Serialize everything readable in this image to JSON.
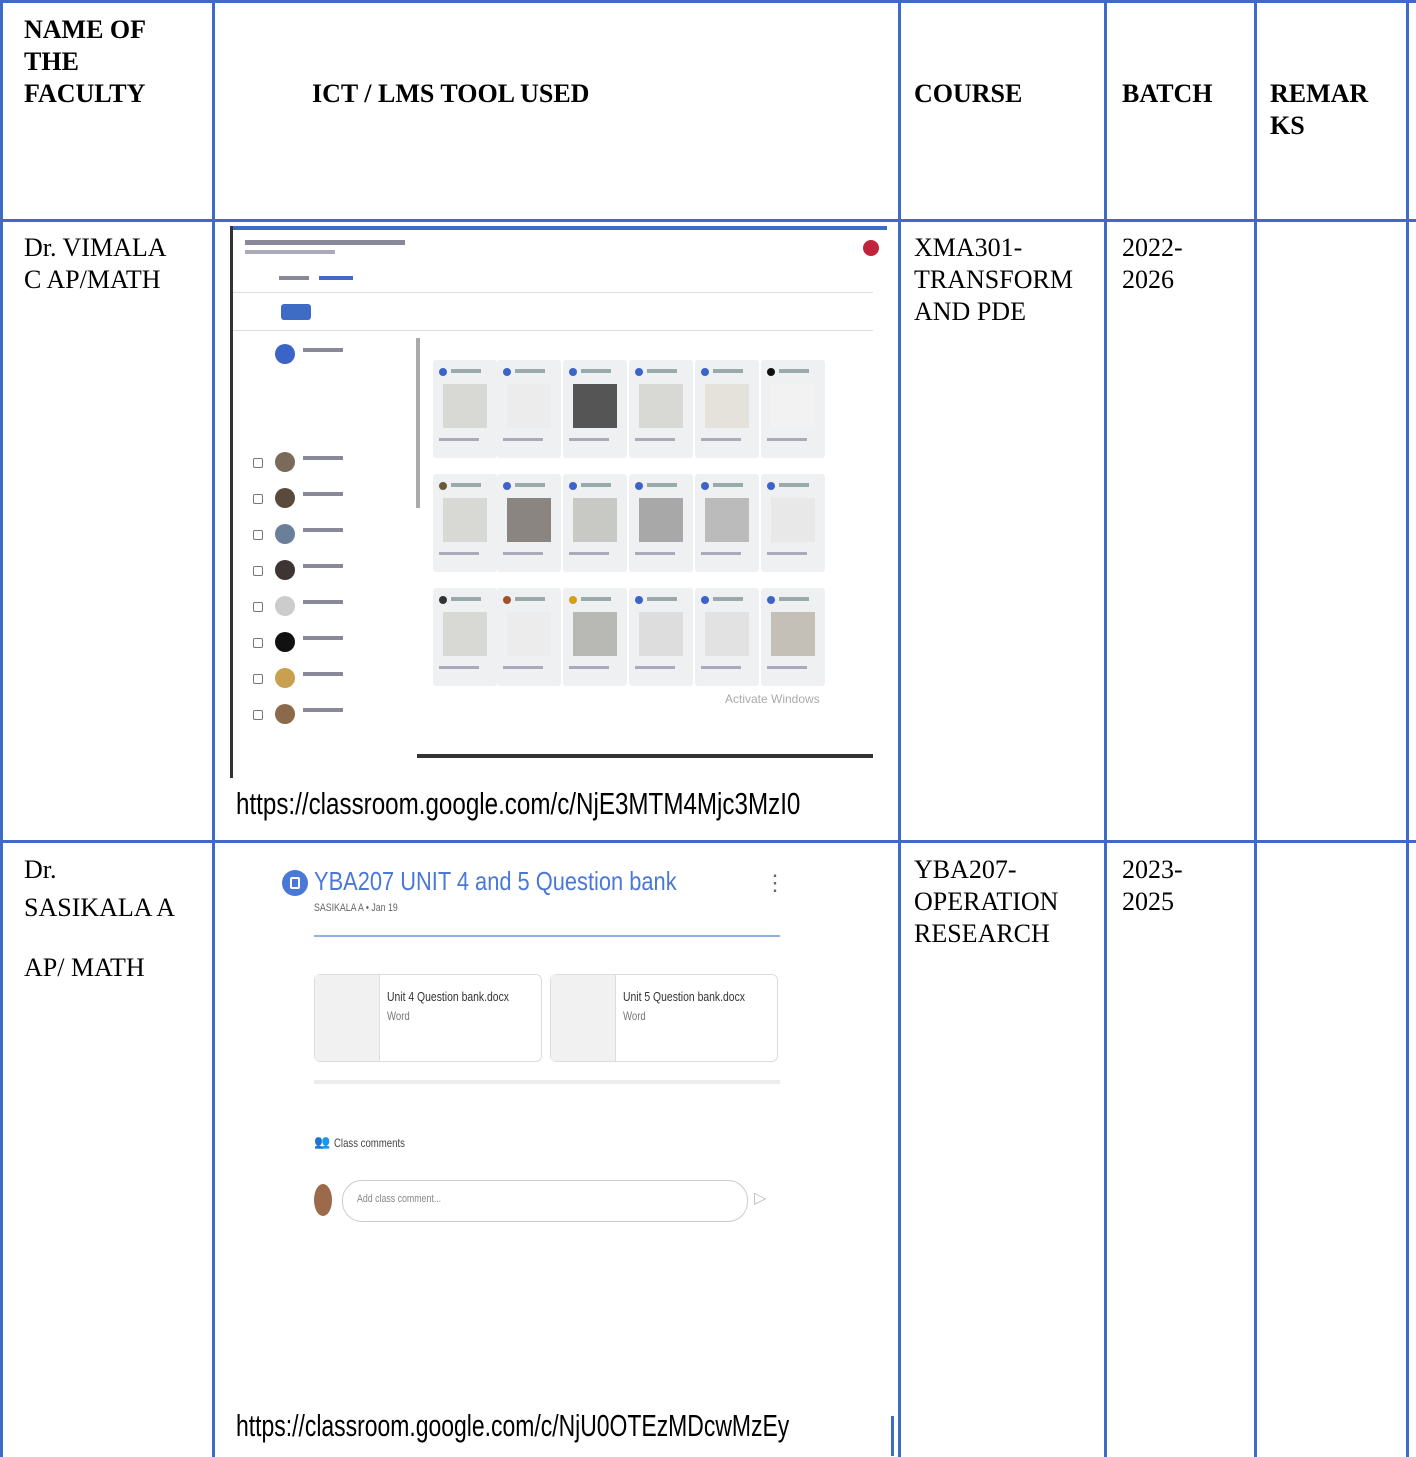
{
  "table": {
    "headers": {
      "faculty": [
        "NAME OF",
        "THE",
        "FACULTY"
      ],
      "tool": "ICT / LMS TOOL USED",
      "course": "COURSE",
      "batch": "BATCH",
      "remarks": [
        "REMAR",
        "KS"
      ]
    },
    "rows": [
      {
        "faculty": [
          "Dr. VIMALA",
          "C AP/MATH"
        ],
        "course": [
          "XMA301-",
          "TRANSFORM",
          "AND PDE"
        ],
        "batch": [
          "2022-",
          "2026"
        ],
        "remarks": "",
        "link": "https://classroom.google.com/c/NjE3MTM4Mjc3MzI0",
        "screenshot": {
          "watermark": "Activate Windows"
        }
      },
      {
        "faculty": [
          "Dr.",
          "SASIKALA A",
          "AP/ MATH"
        ],
        "course": [
          "YBA207-",
          "OPERATION",
          "RESEARCH"
        ],
        "batch": [
          "2023-",
          "2025"
        ],
        "remarks": "",
        "link": "https://classroom.google.com/c/NjU0OTEzMDcwMzEy",
        "screenshot": {
          "title": "YBA207 UNIT 4 and 5 Question bank",
          "meta": "SASIKALA A • Jan 19",
          "attachments": [
            {
              "name": "Unit 4 Question bank.docx",
              "type": "Word"
            },
            {
              "name": "Unit 5 Question bank.docx",
              "type": "Word"
            }
          ],
          "comments_label": "Class comments",
          "comment_placeholder": "Add class comment..."
        }
      }
    ]
  },
  "colors": {
    "border": "#3e6bc4",
    "classroom_blue": "#4a78d8"
  }
}
